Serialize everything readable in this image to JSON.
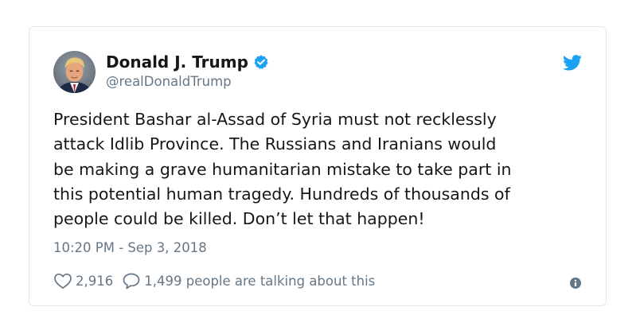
{
  "tweet": {
    "author": {
      "display_name": "Donald J. Trump",
      "handle": "@realDonaldTrump",
      "verified": true
    },
    "text": "President Bashar al-Assad of Syria must not recklessly\nattack Idlib Province. The Russians and Iranians would\nbe making a grave humanitarian mistake to take part in\nthis potential human tragedy. Hundreds of thousands of\npeople could be killed. Don’t let that happen!",
    "timestamp": "10:20 PM - Sep 3, 2018",
    "likes": "2,916",
    "conversation": "1,499 people are talking about this"
  },
  "icons": {
    "like": "heart-icon",
    "reply": "speech-bubble-icon",
    "info": "info-icon",
    "brand": "twitter-bird-icon",
    "verified": "verified-badge-icon"
  },
  "colors": {
    "brand": "#1da1f2",
    "text": "#14171a",
    "secondary": "#657786",
    "border": "#e1e8ed"
  }
}
